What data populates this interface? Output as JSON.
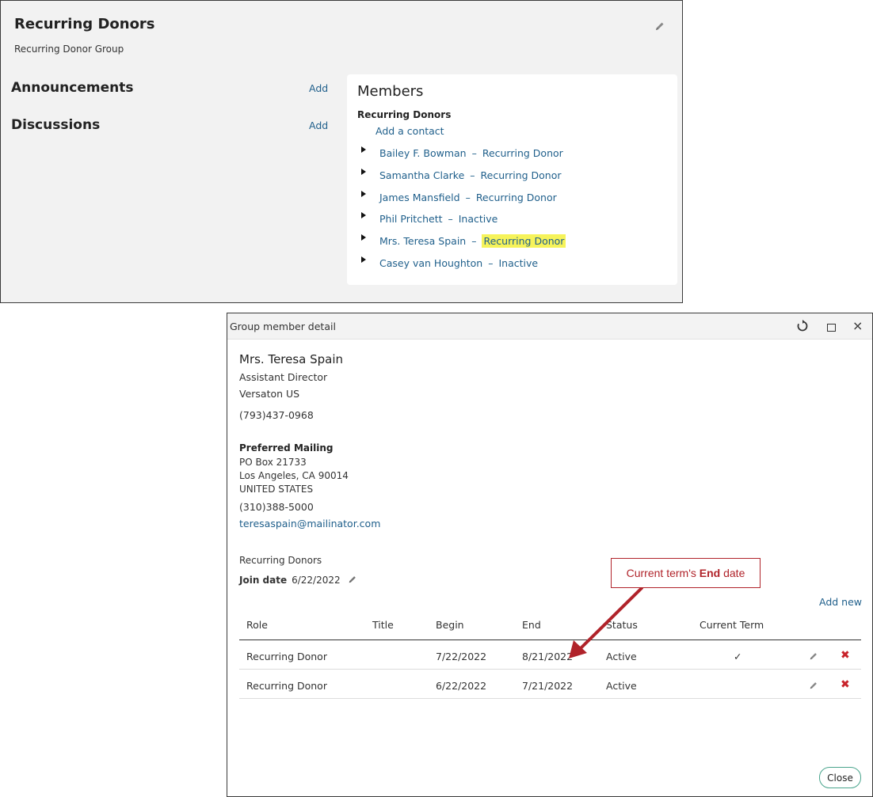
{
  "group": {
    "title": "Recurring Donors",
    "subtitle": "Recurring Donor Group",
    "edit_icon": "pencil-icon",
    "announcements": {
      "label": "Announcements",
      "add": "Add"
    },
    "discussions": {
      "label": "Discussions",
      "add": "Add"
    },
    "members": {
      "heading": "Members",
      "group_label": "Recurring Donors",
      "add_contact": "Add a contact",
      "items": [
        {
          "name": "Bailey F. Bowman",
          "role": "Recurring Donor",
          "highlighted": false
        },
        {
          "name": "Samantha Clarke",
          "role": "Recurring Donor",
          "highlighted": false
        },
        {
          "name": "James Mansfield",
          "role": "Recurring Donor",
          "highlighted": false
        },
        {
          "name": "Phil Pritchett",
          "role": "Inactive",
          "highlighted": false
        },
        {
          "name": "Mrs. Teresa Spain",
          "role": "Recurring Donor",
          "highlighted": true
        },
        {
          "name": "Casey van Houghton",
          "role": "Inactive",
          "highlighted": false
        }
      ],
      "separator": "–",
      "highlight_color": "#f6f35a"
    }
  },
  "dialog": {
    "title": "Group member detail",
    "refresh_icon": "refresh-icon",
    "maximize_icon": "maximize-icon",
    "close_icon_glyph": "×",
    "contact": {
      "name": "Mrs. Teresa Spain",
      "job_title": "Assistant Director",
      "company": "Versaton US",
      "phone": "(793)437-0968",
      "mailing_label": "Preferred Mailing",
      "address_line1": "PO Box 21733",
      "address_line2": "Los Angeles, CA 90014",
      "address_line3": "UNITED STATES",
      "mailing_phone": "(310)388-5000",
      "email": "teresaspain@mailinator.com"
    },
    "group_name": "Recurring Donors",
    "join_date_label": "Join date",
    "join_date": "6/22/2022",
    "add_new": "Add new",
    "table": {
      "headers": {
        "role": "Role",
        "title": "Title",
        "begin": "Begin",
        "end": "End",
        "status": "Status",
        "current_term": "Current Term"
      },
      "rows": [
        {
          "role": "Recurring Donor",
          "title": "",
          "begin": "7/22/2022",
          "end": "8/21/2022",
          "status": "Active",
          "current": "✓"
        },
        {
          "role": "Recurring Donor",
          "title": "",
          "begin": "6/22/2022",
          "end": "7/21/2022",
          "status": "Active",
          "current": ""
        }
      ],
      "delete_glyph": "✖"
    },
    "close_button": "Close"
  },
  "callout": {
    "prefix": "Current term's ",
    "bold": "End",
    "suffix": " date",
    "color": "#b0232a"
  },
  "colors": {
    "link": "#1f5f8b",
    "accent": "#4aa58d",
    "delete": "#c8242b"
  }
}
